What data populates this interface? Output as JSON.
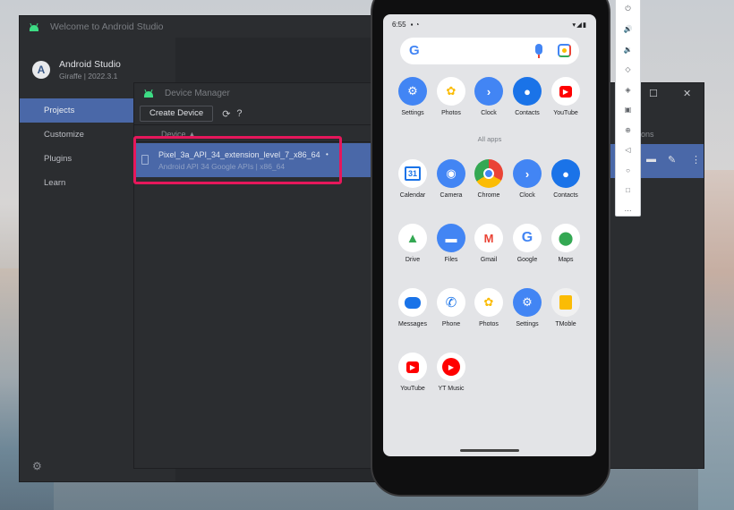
{
  "welcome": {
    "title": "Welcome to Android Studio",
    "product_name": "Android Studio",
    "version": "Giraffe | 2022.3.1",
    "nav": [
      "Projects",
      "Customize",
      "Plugins",
      "Learn"
    ]
  },
  "device_manager": {
    "title": "Device Manager",
    "create_label": "Create Device",
    "column_header": "Device",
    "device": {
      "name": "Pixel_3a_API_34_extension_level_7_x86_64",
      "subtitle": "Android API 34 Google APIs | x86_64"
    }
  },
  "running_window": {
    "header_partial": "ons"
  },
  "emulator_toolbar": [
    "power-icon",
    "volume-up-icon",
    "volume-down-icon",
    "rotate-left-icon",
    "rotate-right-icon",
    "camera-icon",
    "zoom-icon",
    "back-icon",
    "home-icon",
    "overview-icon",
    "more-icon"
  ],
  "phone": {
    "status_time": "6:55",
    "search_logo": "G",
    "all_apps_label": "All apps",
    "pinned_apps": [
      {
        "label": "Settings"
      },
      {
        "label": "Photos"
      },
      {
        "label": "Clock"
      },
      {
        "label": "Contacts"
      },
      {
        "label": "YouTube"
      }
    ],
    "app_grid": [
      {
        "label": "Calendar"
      },
      {
        "label": "Camera"
      },
      {
        "label": "Chrome"
      },
      {
        "label": "Clock"
      },
      {
        "label": "Contacts"
      },
      {
        "label": "Drive"
      },
      {
        "label": "Files"
      },
      {
        "label": "Gmail"
      },
      {
        "label": "Google"
      },
      {
        "label": "Maps"
      },
      {
        "label": "Messages"
      },
      {
        "label": "Phone"
      },
      {
        "label": "Photos"
      },
      {
        "label": "Settings"
      },
      {
        "label": "TMoble"
      },
      {
        "label": "YouTube"
      },
      {
        "label": "YT Music"
      }
    ]
  },
  "colors": {
    "selection": "#4a68a8",
    "highlight_box": "#e6175b",
    "android_green": "#3ddc84"
  }
}
